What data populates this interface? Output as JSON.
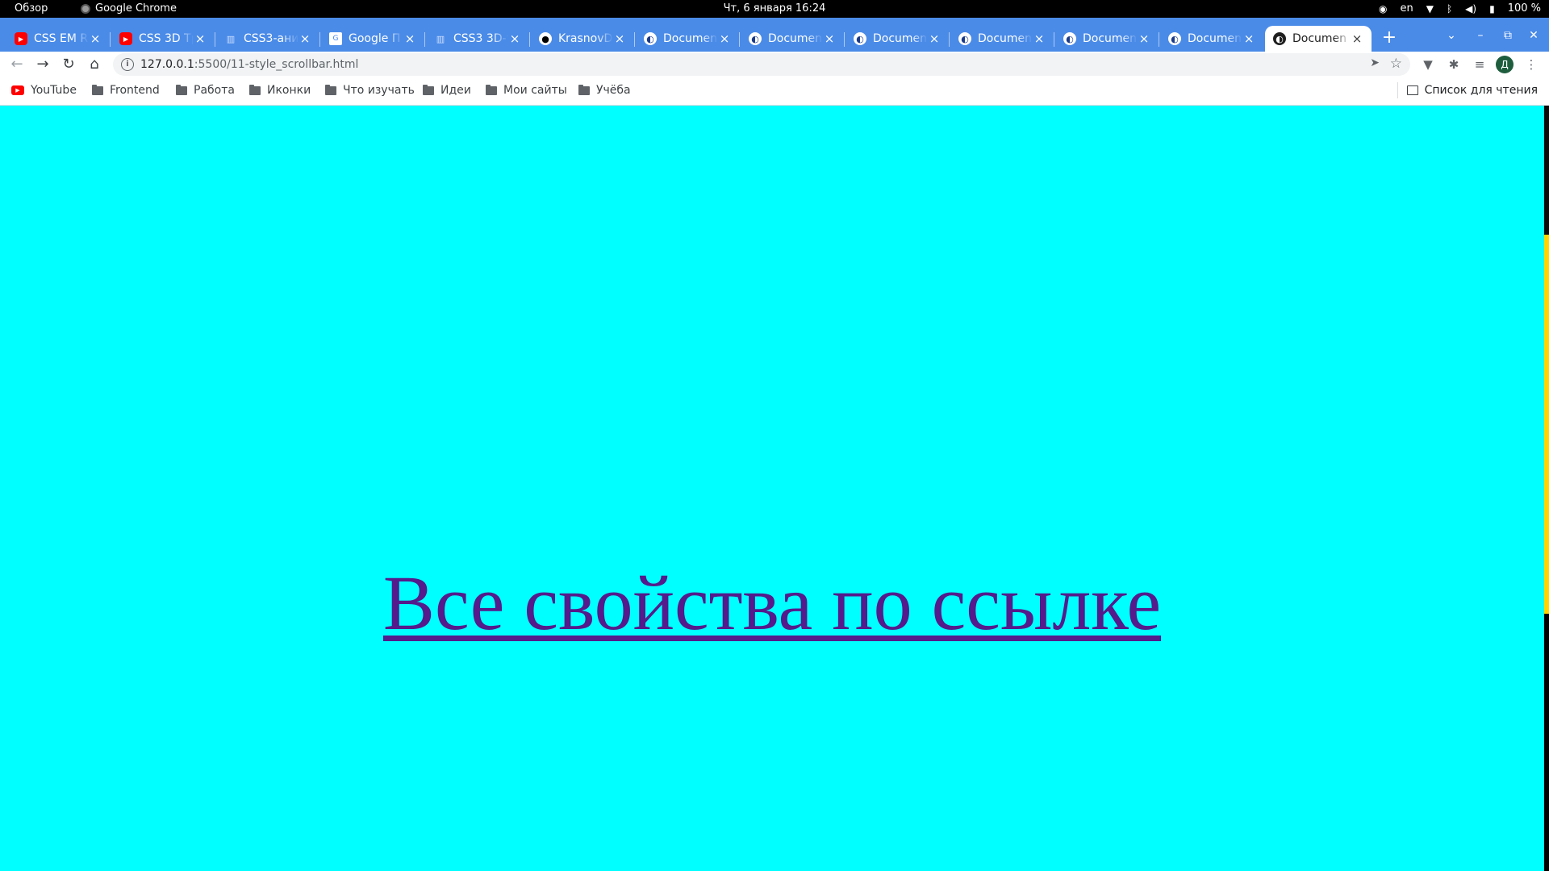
{
  "system_bar": {
    "overview": "Обзор",
    "app_name": "Google Chrome",
    "clock": "Чт, 6 января  16:24",
    "keyboard_layout": "en",
    "battery": "100 %"
  },
  "tabs": [
    {
      "title": "CSS EM RE",
      "favicon": "youtube-icon"
    },
    {
      "title": "CSS 3D Тр",
      "favicon": "youtube-icon"
    },
    {
      "title": "CSS3-ани",
      "favicon": "htmlbook-icon"
    },
    {
      "title": "Google П",
      "favicon": "google-translate-icon"
    },
    {
      "title": "CSS3 3D-т",
      "favicon": "htmlbook-icon"
    },
    {
      "title": "KrasnovD",
      "favicon": "github-icon"
    },
    {
      "title": "Documen",
      "favicon": "globe-icon"
    },
    {
      "title": "Documen",
      "favicon": "globe-icon"
    },
    {
      "title": "Documen",
      "favicon": "globe-icon"
    },
    {
      "title": "Documen",
      "favicon": "globe-icon"
    },
    {
      "title": "Documen",
      "favicon": "globe-icon"
    },
    {
      "title": "Documen",
      "favicon": "globe-icon"
    },
    {
      "title": "Documen",
      "favicon": "globe-icon",
      "active": true
    }
  ],
  "toolbar": {
    "url_host": "127.0.0.1",
    "url_rest": ":5500/11-style_scrollbar.html",
    "profile_initial": "Д"
  },
  "bookmarks": {
    "items": [
      {
        "label": "YouTube",
        "icon": "youtube-icon"
      },
      {
        "label": "Frontend",
        "icon": "folder-icon"
      },
      {
        "label": "Работа",
        "icon": "folder-icon"
      },
      {
        "label": "Иконки",
        "icon": "folder-icon"
      },
      {
        "label": "Что изучать",
        "icon": "folder-icon"
      },
      {
        "label": "Идеи",
        "icon": "folder-icon"
      },
      {
        "label": "Мои сайты",
        "icon": "folder-icon"
      },
      {
        "label": "Учёба",
        "icon": "folder-icon"
      }
    ],
    "reading_list": "Список для чтения"
  },
  "page": {
    "link_text": "Все свойства по ссылке",
    "background_color": "#00ffff",
    "link_color": "#551a8b",
    "scrollbar_thumb_color": "#ffd400",
    "scrollbar_track_color": "#000000"
  }
}
